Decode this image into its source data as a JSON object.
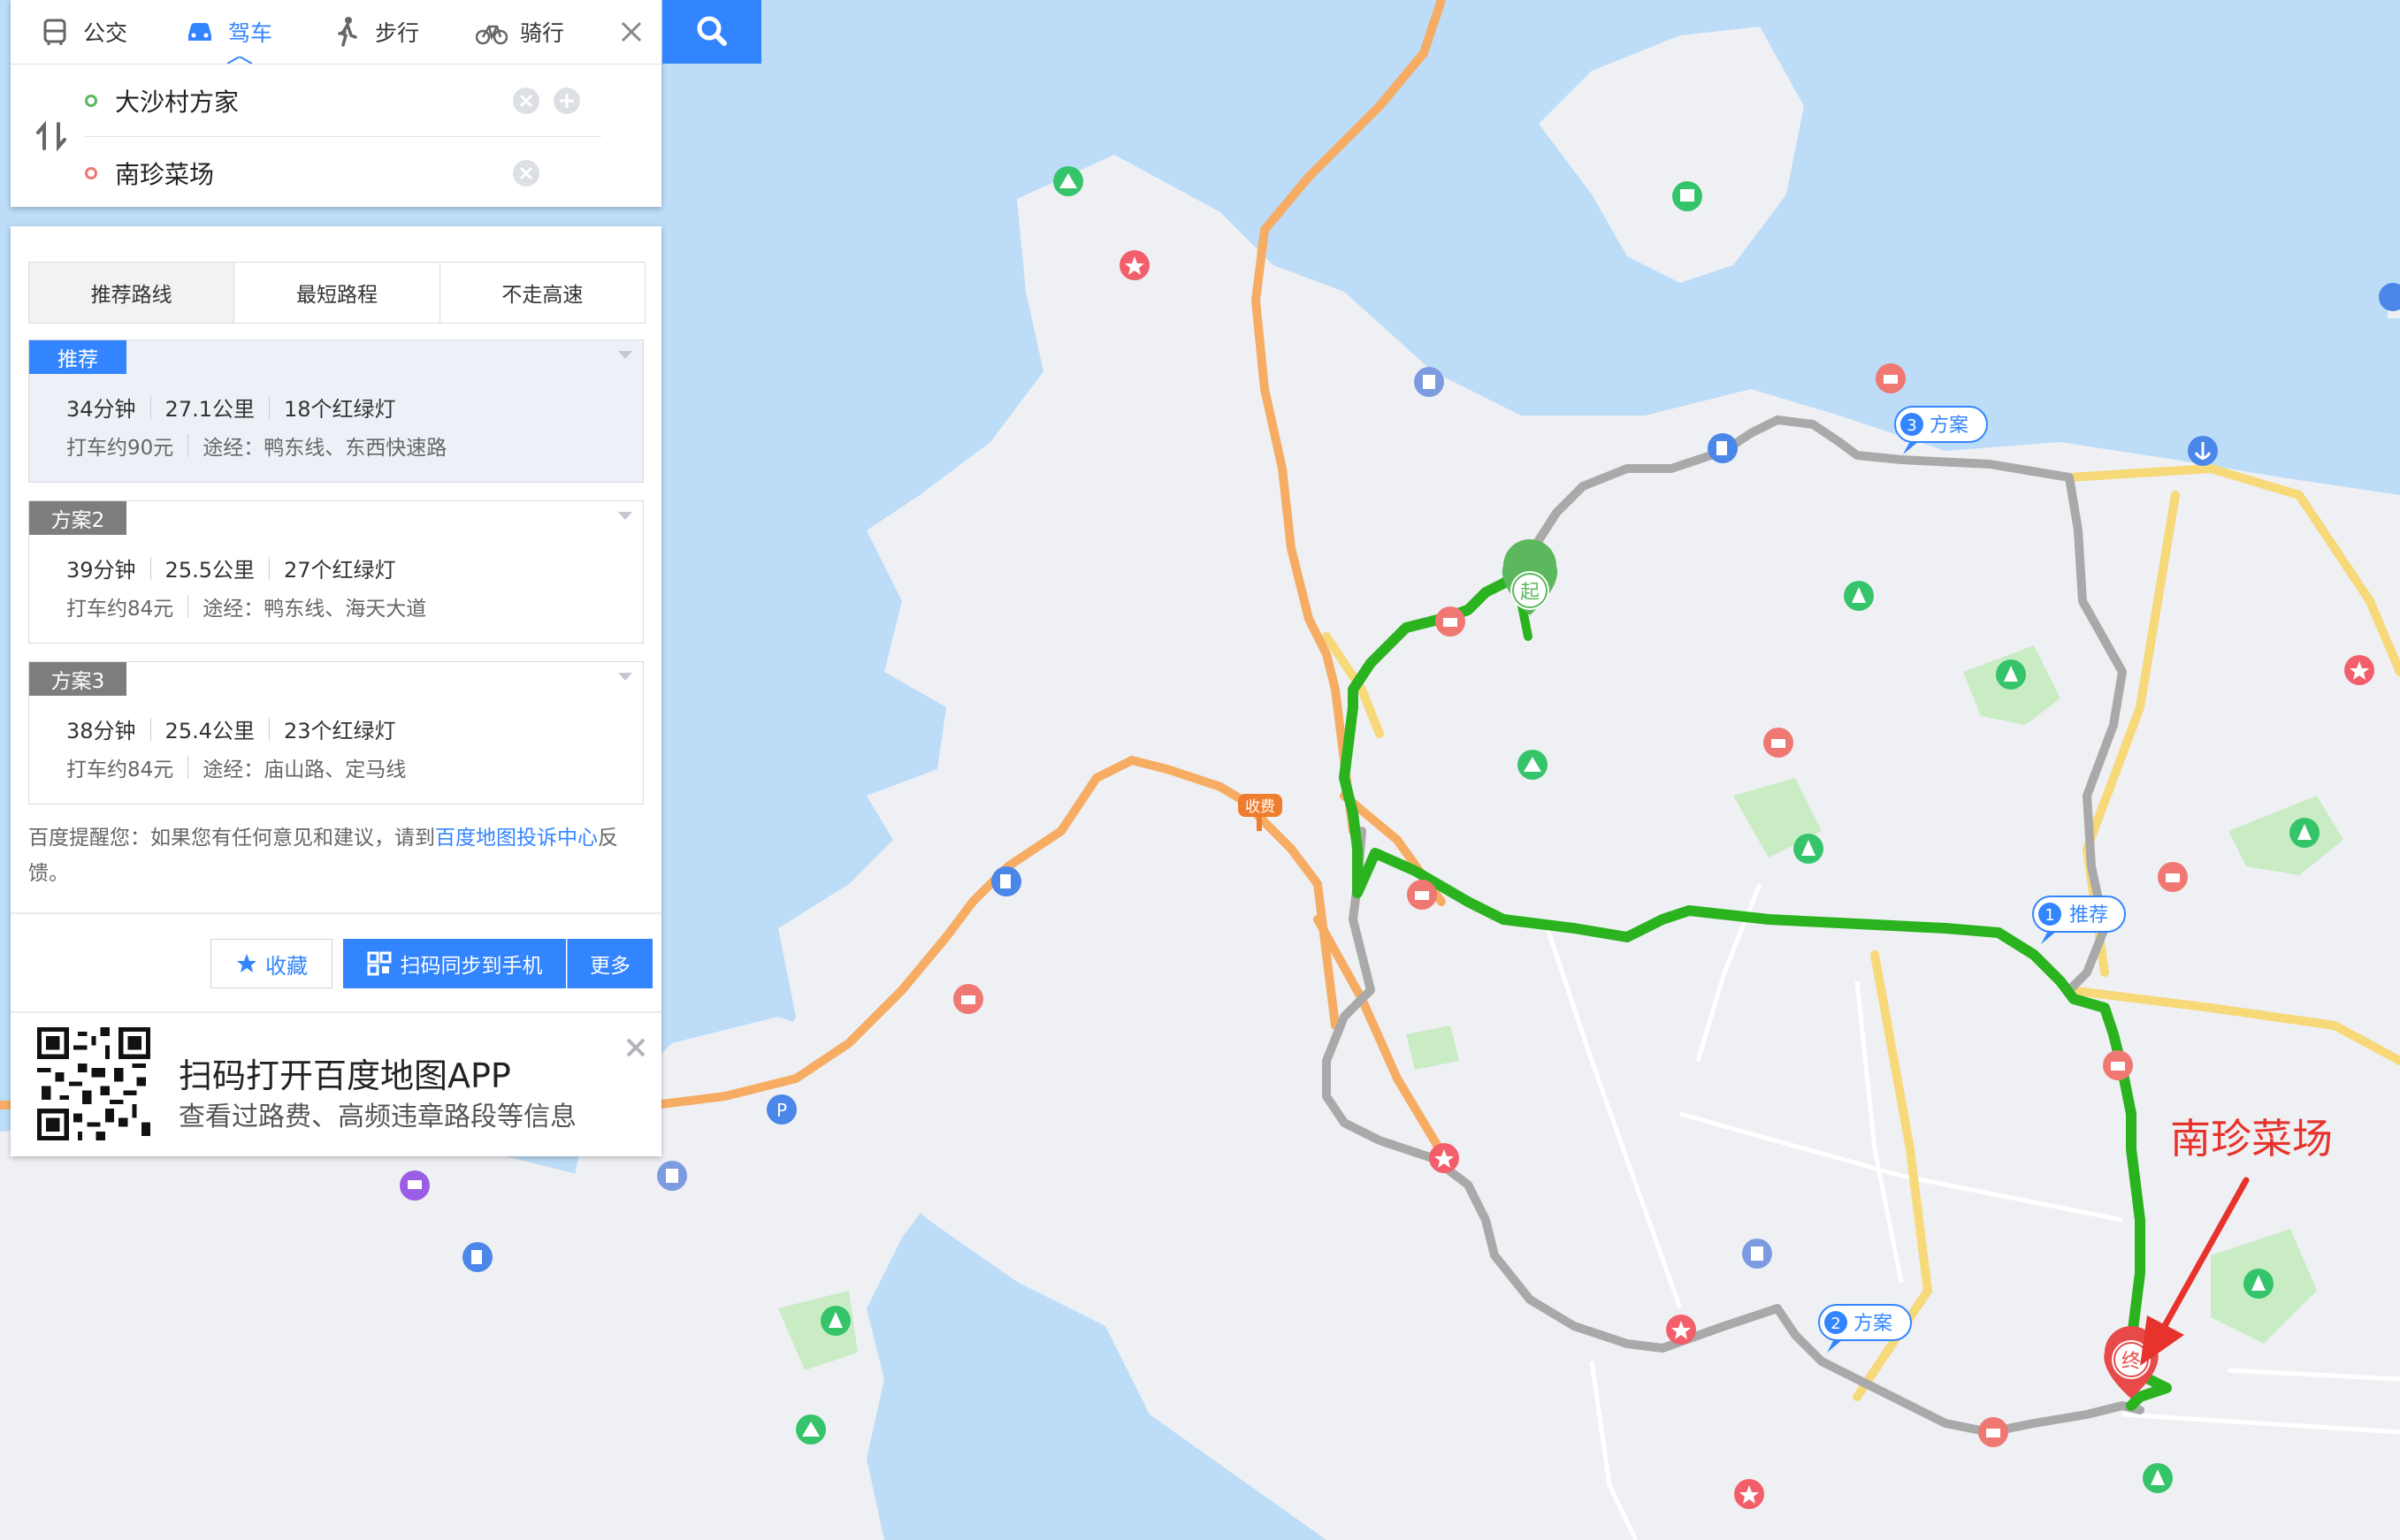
{
  "modes": {
    "bus": "公交",
    "drive": "驾车",
    "walk": "步行",
    "bike": "骑行"
  },
  "route_input": {
    "start": "大沙村方家",
    "end": "南珍菜场"
  },
  "strategy_tabs": [
    "推荐路线",
    "最短路程",
    "不走高速"
  ],
  "routes": [
    {
      "tag": "推荐",
      "time": "34分钟",
      "distance": "27.1公里",
      "lights": "18个红绿灯",
      "taxi": "打车约90元",
      "via": "途经：鸭东线、东西快速路"
    },
    {
      "tag": "方案2",
      "time": "39分钟",
      "distance": "25.5公里",
      "lights": "27个红绿灯",
      "taxi": "打车约84元",
      "via": "途经：鸭东线、海天大道"
    },
    {
      "tag": "方案3",
      "time": "38分钟",
      "distance": "25.4公里",
      "lights": "23个红绿灯",
      "taxi": "打车约84元",
      "via": "途经：庙山路、定马线"
    }
  ],
  "notice": {
    "prefix": "百度提醒您：如果您有任何意见和建议，请到",
    "link": "百度地图投诉中心",
    "suffix": "反馈。"
  },
  "actions": {
    "favorite": "收藏",
    "sync": "扫码同步到手机",
    "more": "更多"
  },
  "app_promo": {
    "title": "扫码打开百度地图APP",
    "subtitle": "查看过路费、高频违章路段等信息"
  },
  "map": {
    "route_labels": {
      "route1_num": "1",
      "route1": "推荐",
      "route2_num": "2",
      "route2": "方案",
      "route3_num": "3",
      "route3": "方案"
    },
    "start_marker": "起",
    "end_marker": "终",
    "toll_label": "收费",
    "parking_label": "P"
  },
  "annotation": "南珍菜场",
  "colors": {
    "accent": "#3385ff",
    "route_green": "#2bb31f",
    "route_gray": "#a9a9a9",
    "highway_orange": "#f6ac63",
    "water": "#bcdcf7",
    "land": "#eef0f4",
    "annotation_red": "#e8332c"
  }
}
